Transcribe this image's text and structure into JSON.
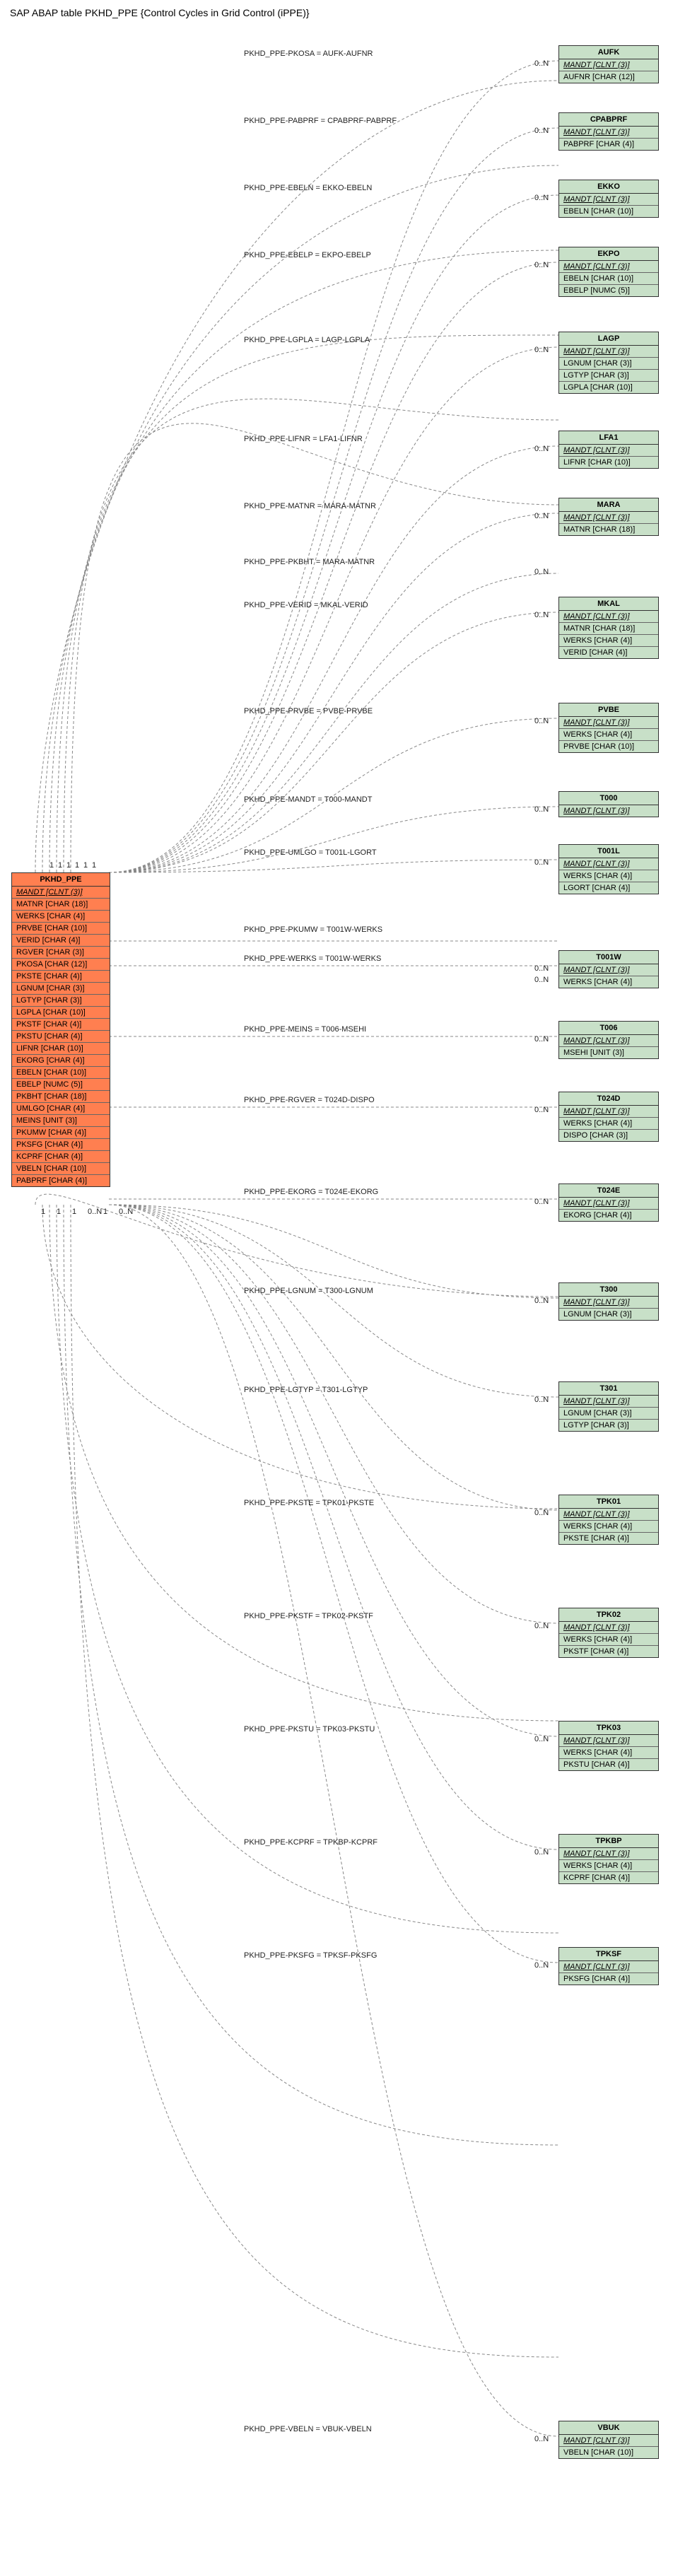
{
  "title": "SAP ABAP table PKHD_PPE {Control Cycles in Grid Control (iPPE)}",
  "main_entity": {
    "name": "PKHD_PPE",
    "fields": [
      {
        "t": "MANDT [CLNT (3)]",
        "key": true
      },
      {
        "t": "MATNR [CHAR (18)]",
        "key": false
      },
      {
        "t": "WERKS [CHAR (4)]",
        "key": false
      },
      {
        "t": "PRVBE [CHAR (10)]",
        "key": false
      },
      {
        "t": "VERID [CHAR (4)]",
        "key": false
      },
      {
        "t": "RGVER [CHAR (3)]",
        "key": false
      },
      {
        "t": "PKOSA [CHAR (12)]",
        "key": false
      },
      {
        "t": "PKSTE [CHAR (4)]",
        "key": false
      },
      {
        "t": "LGNUM [CHAR (3)]",
        "key": false
      },
      {
        "t": "LGTYP [CHAR (3)]",
        "key": false
      },
      {
        "t": "LGPLA [CHAR (10)]",
        "key": false
      },
      {
        "t": "PKSTF [CHAR (4)]",
        "key": false
      },
      {
        "t": "PKSTU [CHAR (4)]",
        "key": false
      },
      {
        "t": "LIFNR [CHAR (10)]",
        "key": false
      },
      {
        "t": "EKORG [CHAR (4)]",
        "key": false
      },
      {
        "t": "EBELN [CHAR (10)]",
        "key": false
      },
      {
        "t": "EBELP [NUMC (5)]",
        "key": false
      },
      {
        "t": "PKBHT [CHAR (18)]",
        "key": false
      },
      {
        "t": "UMLGO [CHAR (4)]",
        "key": false
      },
      {
        "t": "MEINS [UNIT (3)]",
        "key": false
      },
      {
        "t": "PKUMW [CHAR (4)]",
        "key": false
      },
      {
        "t": "PKSFG [CHAR (4)]",
        "key": false
      },
      {
        "t": "KCPRF [CHAR (4)]",
        "key": false
      },
      {
        "t": "VBELN [CHAR (10)]",
        "key": false
      },
      {
        "t": "PABPRF [CHAR (4)]",
        "key": false
      }
    ]
  },
  "refs": [
    {
      "id": "AUFK",
      "label": "PKHD_PPE-PKOSA = AUFK-AUFNR",
      "card0": "1",
      "card1": "0..N",
      "fields": [
        {
          "t": "MANDT [CLNT (3)]",
          "key": true
        },
        {
          "t": "AUFNR [CHAR (12)]",
          "key": false
        }
      ]
    },
    {
      "id": "CPABPRF",
      "label": "PKHD_PPE-PABPRF = CPABPRF-PABPRF",
      "card0": "1",
      "card1": "0..N",
      "fields": [
        {
          "t": "MANDT [CLNT (3)]",
          "key": true
        },
        {
          "t": "PABPRF [CHAR (4)]",
          "key": false
        }
      ]
    },
    {
      "id": "EKKO",
      "label": "PKHD_PPE-EBELN = EKKO-EBELN",
      "card0": "1",
      "card1": "0..N",
      "fields": [
        {
          "t": "MANDT [CLNT (3)]",
          "key": true
        },
        {
          "t": "EBELN [CHAR (10)]",
          "key": false
        }
      ]
    },
    {
      "id": "EKPO",
      "label": "PKHD_PPE-EBELP = EKPO-EBELP",
      "card0": "1",
      "card1": "0..N",
      "fields": [
        {
          "t": "MANDT [CLNT (3)]",
          "key": true
        },
        {
          "t": "EBELN [CHAR (10)]",
          "key": false
        },
        {
          "t": "EBELP [NUMC (5)]",
          "key": false
        }
      ]
    },
    {
      "id": "LAGP",
      "label": "PKHD_PPE-LGPLA = LAGP-LGPLA",
      "card0": "1",
      "card1": "0..N",
      "fields": [
        {
          "t": "MANDT [CLNT (3)]",
          "key": true
        },
        {
          "t": "LGNUM [CHAR (3)]",
          "key": false
        },
        {
          "t": "LGTYP [CHAR (3)]",
          "key": false
        },
        {
          "t": "LGPLA [CHAR (10)]",
          "key": false
        }
      ]
    },
    {
      "id": "LFA1",
      "label": "PKHD_PPE-LIFNR = LFA1-LIFNR",
      "card0": "1",
      "card1": "0..N",
      "fields": [
        {
          "t": "MANDT [CLNT (3)]",
          "key": true
        },
        {
          "t": "LIFNR [CHAR (10)]",
          "key": false
        }
      ]
    },
    {
      "id": "MARA",
      "label": "PKHD_PPE-MATNR = MARA-MATNR",
      "card0": "1",
      "card1": "0..N",
      "fields": [
        {
          "t": "MANDT [CLNT (3)]",
          "key": true
        },
        {
          "t": "MATNR [CHAR (18)]",
          "key": false
        }
      ]
    },
    {
      "id": "MARA2",
      "hdr": "",
      "label": "PKHD_PPE-PKBHT = MARA-MATNR",
      "card0": "1",
      "card1": "0..N",
      "stub": true
    },
    {
      "id": "MKAL",
      "label": "PKHD_PPE-VERID = MKAL-VERID",
      "card0": "1",
      "card1": "0..N",
      "fields": [
        {
          "t": "MANDT [CLNT (3)]",
          "key": true
        },
        {
          "t": "MATNR [CHAR (18)]",
          "key": false
        },
        {
          "t": "WERKS [CHAR (4)]",
          "key": false
        },
        {
          "t": "VERID [CHAR (4)]",
          "key": false
        }
      ]
    },
    {
      "id": "PVBE",
      "label": "PKHD_PPE-PRVBE = PVBE-PRVBE",
      "card0": "0..N",
      "card1": "0..N",
      "fields": [
        {
          "t": "MANDT [CLNT (3)]",
          "key": true
        },
        {
          "t": "WERKS [CHAR (4)]",
          "key": false
        },
        {
          "t": "PRVBE [CHAR (10)]",
          "key": false
        }
      ]
    },
    {
      "id": "T000",
      "label": "PKHD_PPE-MANDT = T000-MANDT",
      "card0": "1",
      "card1": "0..N",
      "fields": [
        {
          "t": "MANDT [CLNT (3)]",
          "key": true
        }
      ]
    },
    {
      "id": "T001L",
      "label": "PKHD_PPE-UMLGO = T001L-LGORT",
      "card0": "0..N",
      "card1": "0..N",
      "fields": [
        {
          "t": "MANDT [CLNT (3)]",
          "key": true
        },
        {
          "t": "WERKS [CHAR (4)]",
          "key": false
        },
        {
          "t": "LGORT [CHAR (4)]",
          "key": false
        }
      ]
    },
    {
      "id": "T001W_PKUMW",
      "label": "PKHD_PPE-PKUMW = T001W-WERKS",
      "card0": "1",
      "card1": "",
      "stub": true
    },
    {
      "id": "T001W",
      "label": "PKHD_PPE-WERKS = T001W-WERKS",
      "card0": "1",
      "card1": "0..N",
      "card1b": "0..N",
      "fields": [
        {
          "t": "MANDT [CLNT (3)]",
          "key": true
        },
        {
          "t": "WERKS [CHAR (4)]",
          "key": false
        }
      ]
    },
    {
      "id": "T006",
      "label": "PKHD_PPE-MEINS = T006-MSEHI",
      "card0": "0..N",
      "card1": "0..N",
      "fields": [
        {
          "t": "MANDT [CLNT (3)]",
          "key": true
        },
        {
          "t": "MSEHI [UNIT (3)]",
          "key": false
        }
      ]
    },
    {
      "id": "T024D",
      "label": "PKHD_PPE-RGVER = T024D-DISPO",
      "card0": "0..N",
      "card1": "0..N",
      "fields": [
        {
          "t": "MANDT [CLNT (3)]",
          "key": true
        },
        {
          "t": "WERKS [CHAR (4)]",
          "key": false
        },
        {
          "t": "DISPO [CHAR (3)]",
          "key": false
        }
      ]
    },
    {
      "id": "T024E",
      "label": "PKHD_PPE-EKORG = T024E-EKORG",
      "card0": "1",
      "card1": "0..N",
      "fields": [
        {
          "t": "MANDT [CLNT (3)]",
          "key": true
        },
        {
          "t": "EKORG [CHAR (4)]",
          "key": false
        }
      ]
    },
    {
      "id": "T300",
      "label": "PKHD_PPE-LGNUM = T300-LGNUM",
      "card0": "0..N",
      "card1": "0..N",
      "fields": [
        {
          "t": "MANDT [CLNT (3)]",
          "key": true
        },
        {
          "t": "LGNUM [CHAR (3)]",
          "key": false
        }
      ]
    },
    {
      "id": "T301",
      "label": "PKHD_PPE-LGTYP = T301-LGTYP",
      "card0": "0..N",
      "card1": "0..N",
      "fields": [
        {
          "t": "MANDT [CLNT (3)]",
          "key": true
        },
        {
          "t": "LGNUM [CHAR (3)]",
          "key": false
        },
        {
          "t": "LGTYP [CHAR (3)]",
          "key": false
        }
      ]
    },
    {
      "id": "TPK01",
      "label": "PKHD_PPE-PKSTE = TPK01-PKSTE",
      "card0": "1",
      "card1": "0..N",
      "fields": [
        {
          "t": "MANDT [CLNT (3)]",
          "key": true
        },
        {
          "t": "WERKS [CHAR (4)]",
          "key": false
        },
        {
          "t": "PKSTE [CHAR (4)]",
          "key": false
        }
      ]
    },
    {
      "id": "TPK02",
      "label": "PKHD_PPE-PKSTF = TPK02-PKSTF",
      "card0": "1",
      "card1": "0..N",
      "fields": [
        {
          "t": "MANDT [CLNT (3)]",
          "key": true
        },
        {
          "t": "WERKS [CHAR (4)]",
          "key": false
        },
        {
          "t": "PKSTF [CHAR (4)]",
          "key": false
        }
      ]
    },
    {
      "id": "TPK03",
      "label": "PKHD_PPE-PKSTU = TPK03-PKSTU",
      "card0": "1",
      "card1": "0..N",
      "fields": [
        {
          "t": "MANDT [CLNT (3)]",
          "key": true
        },
        {
          "t": "WERKS [CHAR (4)]",
          "key": false
        },
        {
          "t": "PKSTU [CHAR (4)]",
          "key": false
        }
      ]
    },
    {
      "id": "TPKBP",
      "label": "PKHD_PPE-KCPRF = TPKBP-KCPRF",
      "card0": "1",
      "card1": "0..N",
      "fields": [
        {
          "t": "MANDT [CLNT (3)]",
          "key": true
        },
        {
          "t": "WERKS [CHAR (4)]",
          "key": false
        },
        {
          "t": "KCPRF [CHAR (4)]",
          "key": false
        }
      ]
    },
    {
      "id": "TPKSF",
      "label": "PKHD_PPE-PKSFG = TPKSF-PKSFG",
      "card0": "1",
      "card1": "0..N",
      "fields": [
        {
          "t": "MANDT [CLNT (3)]",
          "key": true
        },
        {
          "t": "PKSFG [CHAR (4)]",
          "key": false
        }
      ]
    },
    {
      "id": "VBUK",
      "label": "PKHD_PPE-VBELN = VBUK-VBELN",
      "card0": "1",
      "card1": "0..N",
      "fields": [
        {
          "t": "MANDT [CLNT (3)]",
          "key": true
        },
        {
          "t": "VBELN [CHAR (10)]",
          "key": false
        }
      ]
    }
  ],
  "left_cards_top": [
    "1",
    "1",
    "1",
    "1",
    "1",
    "1"
  ],
  "left_cards_bottom": [
    "1",
    "1",
    "1",
    "0..N",
    "1",
    "0..N"
  ]
}
